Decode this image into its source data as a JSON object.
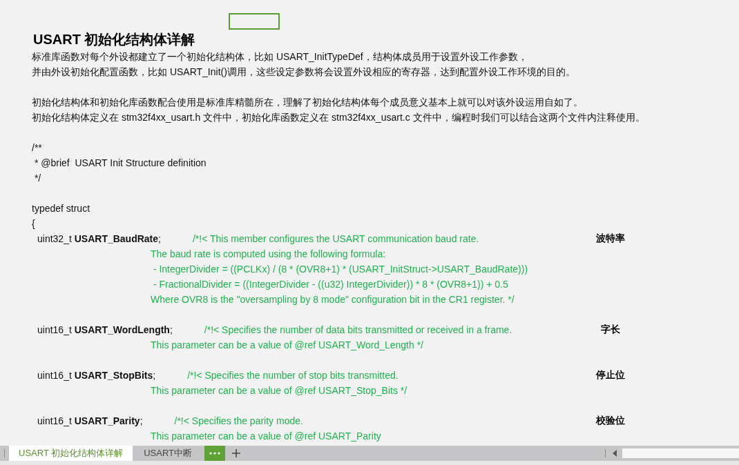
{
  "title": "USART 初始化结构体详解",
  "intro": [
    [
      "标准库函数对每个外设都建立了一个初始化结构体，比如 USART_InitTypeDef，结构体成员用于设置外设工作参数，",
      "并由外设初始化配置函数，比如 USART_Init()调用，这些设定参数将会设置外设相应的寄存器，达到配置外设工作环境的目的。"
    ],
    [
      "初始化结构体和初始化库函数配合使用是标准库精髓所在，理解了初始化结构体每个成员意义基本上就可以对该外设运用自如了。",
      "初始化结构体定义在 stm32f4xx_usart.h 文件中，初始化库函数定义在 stm32f4xx_usart.c 文件中，编程时我们可以结合这两个文件内注释使用。"
    ]
  ],
  "code_header": [
    "/**",
    " * @brief  USART Init Structure definition",
    " */"
  ],
  "code_open": [
    "typedef struct",
    "{"
  ],
  "members": [
    {
      "declaration": "uint32_t **USART_BaudRate**;",
      "comment": [
        "/*!< This member configures the USART communication baud rate.",
        "The baud rate is computed using the following formula:",
        " - IntegerDivider = ((PCLKx) / (8 * (OVR8+1) * (USART_InitStruct->USART_BaudRate)))",
        " - FractionalDivider = ((IntegerDivider - ((u32) IntegerDivider)) * 8 * (OVR8+1)) + 0.5",
        "Where OVR8 is the \"oversampling by 8 mode\" configuration bit in the CR1 register. */"
      ],
      "note": "波特率"
    },
    {
      "declaration": "uint16_t **USART_WordLength**;",
      "comment": [
        "/*!< Specifies the number of data bits transmitted or received in a frame.",
        "This parameter can be a value of @ref USART_Word_Length */"
      ],
      "note": "字长"
    },
    {
      "declaration": "uint16_t **USART_StopBits**;",
      "comment": [
        "/*!< Specifies the number of stop bits transmitted.",
        "This parameter can be a value of @ref USART_Stop_Bits */"
      ],
      "note": "停止位"
    },
    {
      "declaration": "uint16_t **USART_Parity**;",
      "comment": [
        "/*!< Specifies the parity mode.",
        "This parameter can be a value of @ref USART_Parity"
      ],
      "note": "校验位"
    }
  ],
  "sheet_tabs": [
    {
      "label": "USART 初始化结构体详解",
      "selected": true
    },
    {
      "label": "USART中断",
      "selected": false
    }
  ]
}
